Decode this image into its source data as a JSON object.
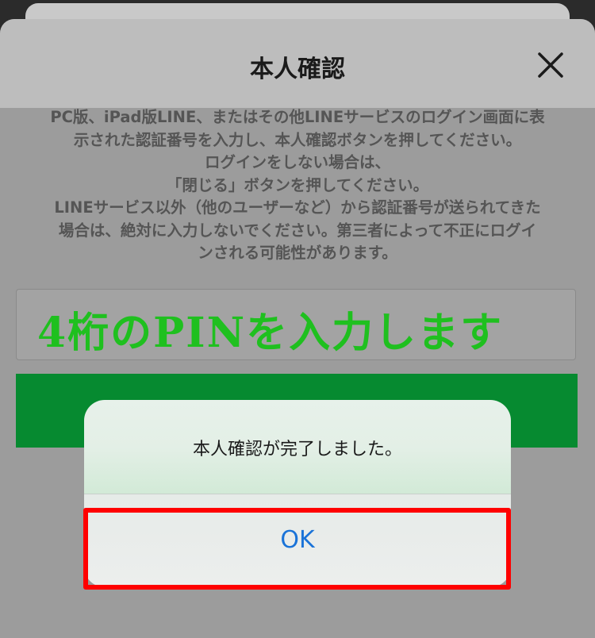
{
  "sheet": {
    "title": "本人確認",
    "close_icon": "close-icon",
    "instructions": [
      "PC版、iPad版LINE、またはその他LINEサービスのログイン画面に表",
      "示された認証番号を入力し、本人確認ボタンを押してください。",
      "ログインをしない場合は、",
      "「閉じる」ボタンを押してください。",
      "LINEサービス以外（他のユーザーなど）から認証番号が送られてきた",
      "場合は、絶対に入力しないでください。第三者によって不正にログイ",
      "ンされる可能性があります。"
    ]
  },
  "pin_field": {
    "annotation": "4桁のPINを入力します"
  },
  "alert": {
    "message": "本人確認が完了しました。",
    "ok_label": "OK"
  },
  "colors": {
    "confirm_button": "#068a30",
    "annotation_text": "#1fc01f",
    "highlight_border": "#ff0000",
    "ok_text": "#1a73d8"
  }
}
